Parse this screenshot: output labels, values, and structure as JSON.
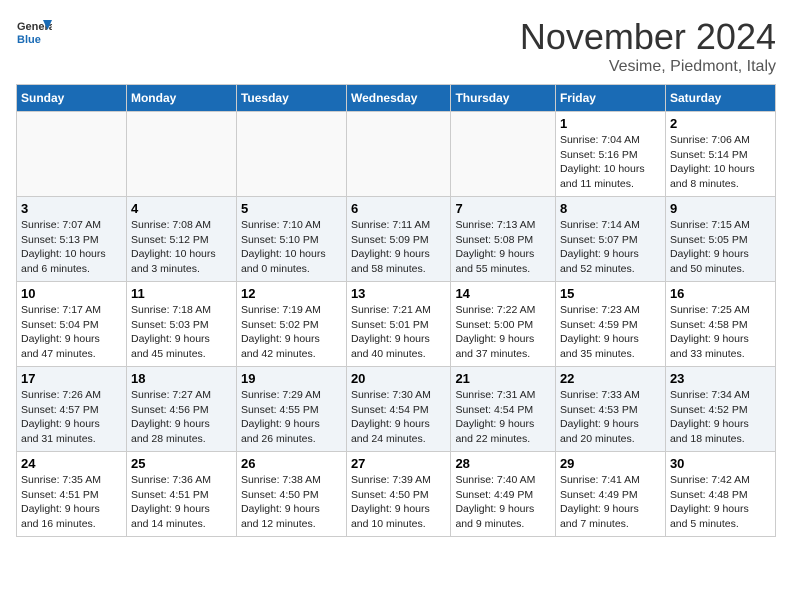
{
  "logo": {
    "line1": "General",
    "line2": "Blue"
  },
  "title": "November 2024",
  "location": "Vesime, Piedmont, Italy",
  "days_of_week": [
    "Sunday",
    "Monday",
    "Tuesday",
    "Wednesday",
    "Thursday",
    "Friday",
    "Saturday"
  ],
  "weeks": [
    [
      {
        "day": "",
        "info": ""
      },
      {
        "day": "",
        "info": ""
      },
      {
        "day": "",
        "info": ""
      },
      {
        "day": "",
        "info": ""
      },
      {
        "day": "",
        "info": ""
      },
      {
        "day": "1",
        "info": "Sunrise: 7:04 AM\nSunset: 5:16 PM\nDaylight: 10 hours\nand 11 minutes."
      },
      {
        "day": "2",
        "info": "Sunrise: 7:06 AM\nSunset: 5:14 PM\nDaylight: 10 hours\nand 8 minutes."
      }
    ],
    [
      {
        "day": "3",
        "info": "Sunrise: 7:07 AM\nSunset: 5:13 PM\nDaylight: 10 hours\nand 6 minutes."
      },
      {
        "day": "4",
        "info": "Sunrise: 7:08 AM\nSunset: 5:12 PM\nDaylight: 10 hours\nand 3 minutes."
      },
      {
        "day": "5",
        "info": "Sunrise: 7:10 AM\nSunset: 5:10 PM\nDaylight: 10 hours\nand 0 minutes."
      },
      {
        "day": "6",
        "info": "Sunrise: 7:11 AM\nSunset: 5:09 PM\nDaylight: 9 hours\nand 58 minutes."
      },
      {
        "day": "7",
        "info": "Sunrise: 7:13 AM\nSunset: 5:08 PM\nDaylight: 9 hours\nand 55 minutes."
      },
      {
        "day": "8",
        "info": "Sunrise: 7:14 AM\nSunset: 5:07 PM\nDaylight: 9 hours\nand 52 minutes."
      },
      {
        "day": "9",
        "info": "Sunrise: 7:15 AM\nSunset: 5:05 PM\nDaylight: 9 hours\nand 50 minutes."
      }
    ],
    [
      {
        "day": "10",
        "info": "Sunrise: 7:17 AM\nSunset: 5:04 PM\nDaylight: 9 hours\nand 47 minutes."
      },
      {
        "day": "11",
        "info": "Sunrise: 7:18 AM\nSunset: 5:03 PM\nDaylight: 9 hours\nand 45 minutes."
      },
      {
        "day": "12",
        "info": "Sunrise: 7:19 AM\nSunset: 5:02 PM\nDaylight: 9 hours\nand 42 minutes."
      },
      {
        "day": "13",
        "info": "Sunrise: 7:21 AM\nSunset: 5:01 PM\nDaylight: 9 hours\nand 40 minutes."
      },
      {
        "day": "14",
        "info": "Sunrise: 7:22 AM\nSunset: 5:00 PM\nDaylight: 9 hours\nand 37 minutes."
      },
      {
        "day": "15",
        "info": "Sunrise: 7:23 AM\nSunset: 4:59 PM\nDaylight: 9 hours\nand 35 minutes."
      },
      {
        "day": "16",
        "info": "Sunrise: 7:25 AM\nSunset: 4:58 PM\nDaylight: 9 hours\nand 33 minutes."
      }
    ],
    [
      {
        "day": "17",
        "info": "Sunrise: 7:26 AM\nSunset: 4:57 PM\nDaylight: 9 hours\nand 31 minutes."
      },
      {
        "day": "18",
        "info": "Sunrise: 7:27 AM\nSunset: 4:56 PM\nDaylight: 9 hours\nand 28 minutes."
      },
      {
        "day": "19",
        "info": "Sunrise: 7:29 AM\nSunset: 4:55 PM\nDaylight: 9 hours\nand 26 minutes."
      },
      {
        "day": "20",
        "info": "Sunrise: 7:30 AM\nSunset: 4:54 PM\nDaylight: 9 hours\nand 24 minutes."
      },
      {
        "day": "21",
        "info": "Sunrise: 7:31 AM\nSunset: 4:54 PM\nDaylight: 9 hours\nand 22 minutes."
      },
      {
        "day": "22",
        "info": "Sunrise: 7:33 AM\nSunset: 4:53 PM\nDaylight: 9 hours\nand 20 minutes."
      },
      {
        "day": "23",
        "info": "Sunrise: 7:34 AM\nSunset: 4:52 PM\nDaylight: 9 hours\nand 18 minutes."
      }
    ],
    [
      {
        "day": "24",
        "info": "Sunrise: 7:35 AM\nSunset: 4:51 PM\nDaylight: 9 hours\nand 16 minutes."
      },
      {
        "day": "25",
        "info": "Sunrise: 7:36 AM\nSunset: 4:51 PM\nDaylight: 9 hours\nand 14 minutes."
      },
      {
        "day": "26",
        "info": "Sunrise: 7:38 AM\nSunset: 4:50 PM\nDaylight: 9 hours\nand 12 minutes."
      },
      {
        "day": "27",
        "info": "Sunrise: 7:39 AM\nSunset: 4:50 PM\nDaylight: 9 hours\nand 10 minutes."
      },
      {
        "day": "28",
        "info": "Sunrise: 7:40 AM\nSunset: 4:49 PM\nDaylight: 9 hours\nand 9 minutes."
      },
      {
        "day": "29",
        "info": "Sunrise: 7:41 AM\nSunset: 4:49 PM\nDaylight: 9 hours\nand 7 minutes."
      },
      {
        "day": "30",
        "info": "Sunrise: 7:42 AM\nSunset: 4:48 PM\nDaylight: 9 hours\nand 5 minutes."
      }
    ]
  ]
}
